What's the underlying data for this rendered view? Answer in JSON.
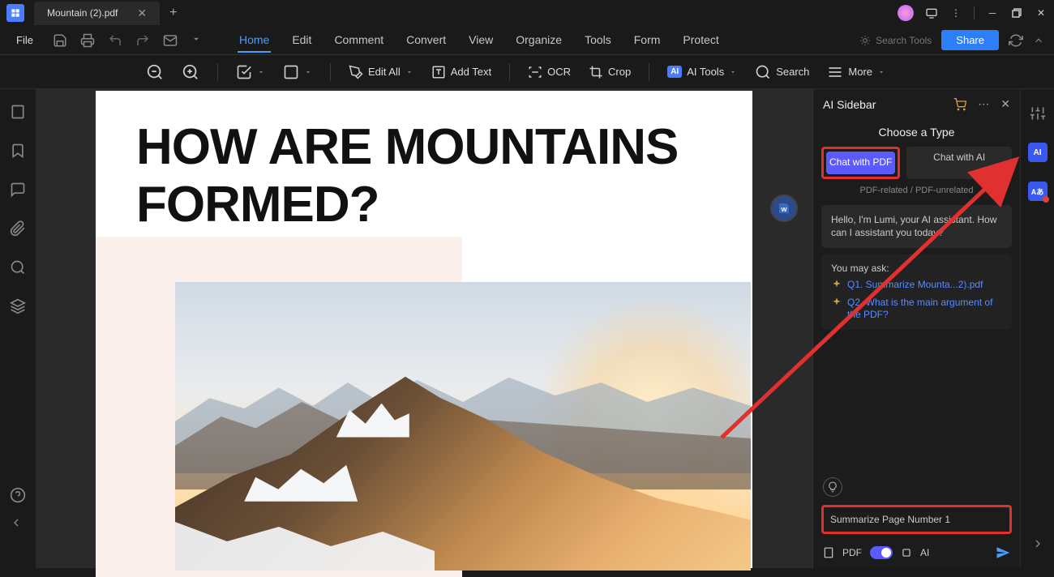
{
  "titlebar": {
    "tab_name": "Mountain (2).pdf"
  },
  "menubar": {
    "file": "File",
    "tabs": [
      "Home",
      "Edit",
      "Comment",
      "Convert",
      "View",
      "Organize",
      "Tools",
      "Form",
      "Protect"
    ],
    "search_tools": "Search Tools",
    "share": "Share"
  },
  "toolbar": {
    "edit_all": "Edit All",
    "add_text": "Add Text",
    "ocr": "OCR",
    "crop": "Crop",
    "ai_tools": "AI Tools",
    "search": "Search",
    "more": "More"
  },
  "document": {
    "heading": "HOW ARE MOUNTAINS FORMED?"
  },
  "ai_sidebar": {
    "title": "AI Sidebar",
    "choose": "Choose a Type",
    "mode_pdf": "Chat with PDF",
    "mode_ai": "Chat with AI",
    "subtext": "PDF-related / PDF-unrelated",
    "greeting": "Hello, I'm Lumi, your AI assistant. How can I assistant you today?",
    "you_may_ask": "You may ask:",
    "q1": "Q1. Summarize Mounta...2).pdf",
    "q2": "Q2. What is the main argument of the PDF?",
    "input_value": "Summarize Page Number 1",
    "pdf_label": "PDF",
    "ai_label": "AI"
  }
}
